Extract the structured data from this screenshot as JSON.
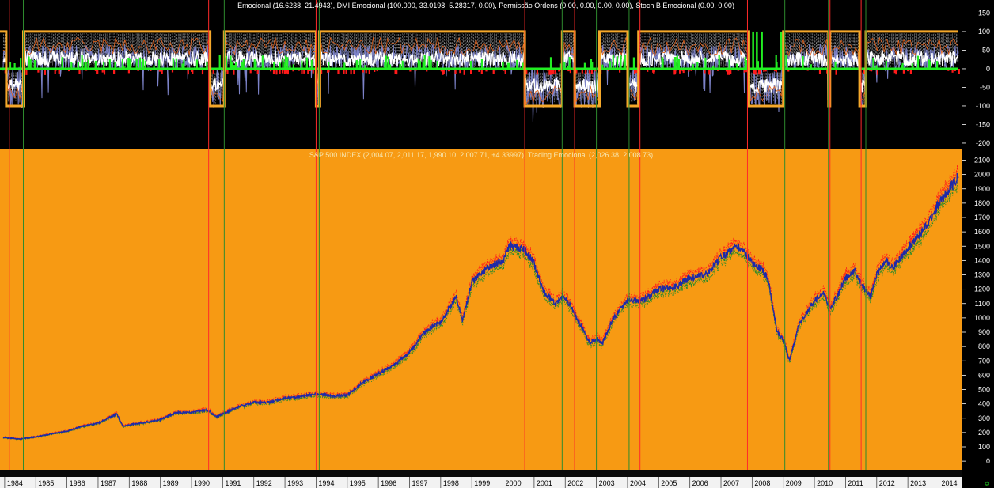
{
  "colors": {
    "osc_bg": "#000000",
    "price_bg": "#F79A13",
    "scale_bg": "#000000",
    "osc_white": "#FFFFFF",
    "osc_blue": "#7C82C8",
    "osc_green": "#22EE22",
    "osc_red": "#FF1A1A",
    "osc_orange_line": "#E0601A",
    "permission_box": "#F5A82A",
    "price_blue": "#1E2AA8",
    "price_red": "#FF1A1A",
    "price_green": "#1F8A2A",
    "vline_red": "#FF2A2A",
    "vline_green": "#2E8B2E",
    "scrollbar": "#000000"
  },
  "oscillator_panel": {
    "legend_text": "Emocional (16.6238, 21.4943), DMI Emocional (100.000, 33.0198, 5.28317, 0.00), Permissão Ordens (0.00, 0.00, 0.00, 0.00), Stoch B Emocional (0.00, 0.00)"
  },
  "price_panel": {
    "legend_text": "S&P 500 INDEX (2,004.07, 2,011.17, 1,990.10, 2,007.71, +4.33997), Trading Emocional (2,026.38, 2,008.73)"
  },
  "chart_data": [
    {
      "type": "line",
      "panel": "oscillator",
      "ylim": [
        -215,
        185
      ],
      "yticks": [
        150,
        100,
        50,
        0,
        -50,
        -100,
        -150,
        -200
      ],
      "ytick_labels": [
        "150",
        "100",
        "50",
        "0",
        "-50",
        "-100",
        "-150",
        "-200"
      ],
      "series": [
        {
          "name": "Permissão Ordens",
          "color": "#F5A82A",
          "segments": [
            {
              "from": 1983.85,
              "to": 1984.05,
              "level": 100
            },
            {
              "from": 1984.05,
              "to": 1984.6,
              "level": -100
            },
            {
              "from": 1984.6,
              "to": 1990.6,
              "level": 100
            },
            {
              "from": 1990.6,
              "to": 1991.05,
              "level": -100
            },
            {
              "from": 1991.05,
              "to": 1994.0,
              "level": 100
            },
            {
              "from": 1994.0,
              "to": 1994.1,
              "level": -100
            },
            {
              "from": 1994.1,
              "to": 2000.7,
              "level": 100
            },
            {
              "from": 2000.7,
              "to": 2001.9,
              "level": -100
            },
            {
              "from": 2001.9,
              "to": 2002.3,
              "level": 100
            },
            {
              "from": 2002.3,
              "to": 2003.1,
              "level": -100
            },
            {
              "from": 2003.1,
              "to": 2004.0,
              "level": 100
            },
            {
              "from": 2004.0,
              "to": 2004.35,
              "level": -100
            },
            {
              "from": 2004.35,
              "to": 2007.9,
              "level": 100
            },
            {
              "from": 2007.9,
              "to": 2009.0,
              "level": -100
            },
            {
              "from": 2009.0,
              "to": 2010.45,
              "level": 100
            },
            {
              "from": 2010.45,
              "to": 2010.5,
              "level": -100
            },
            {
              "from": 2010.5,
              "to": 2011.45,
              "level": 100
            },
            {
              "from": 2011.45,
              "to": 2011.65,
              "level": -100
            },
            {
              "from": 2011.65,
              "to": 2014.6,
              "level": 100
            }
          ]
        },
        {
          "name": "Emocional",
          "color": "#FFFFFF"
        },
        {
          "name": "Stoch B Emocional",
          "color": "#7C82C8"
        },
        {
          "name": "DMI Emocional",
          "color": "#22EE22"
        }
      ]
    },
    {
      "type": "line",
      "panel": "price",
      "title": "S&P 500 INDEX",
      "ylim": [
        -60,
        2180
      ],
      "yticks": [
        2100,
        2000,
        1900,
        1800,
        1700,
        1600,
        1500,
        1400,
        1300,
        1200,
        1100,
        1000,
        900,
        800,
        700,
        600,
        500,
        400,
        300,
        200,
        100,
        0
      ],
      "ytick_labels": [
        "2100",
        "2000",
        "1900",
        "1800",
        "1700",
        "1600",
        "1500",
        "1400",
        "1300",
        "1200",
        "1100",
        "1000",
        "900",
        "800",
        "700",
        "600",
        "500",
        "400",
        "300",
        "200",
        "100",
        "0"
      ],
      "xlim": [
        1983.85,
        2014.75
      ],
      "xticks": [
        1984,
        1985,
        1986,
        1987,
        1988,
        1989,
        1990,
        1991,
        1992,
        1993,
        1994,
        1995,
        1996,
        1997,
        1998,
        1999,
        2000,
        2001,
        2002,
        2003,
        2004,
        2005,
        2006,
        2007,
        2008,
        2009,
        2010,
        2011,
        2012,
        2013,
        2014
      ],
      "xtick_labels": [
        "1984",
        "1985",
        "1986",
        "1987",
        "1988",
        "1989",
        "1990",
        "1991",
        "1992",
        "1993",
        "1994",
        "1995",
        "1996",
        "1997",
        "1998",
        "1999",
        "2000",
        "2001",
        "2002",
        "2003",
        "2004",
        "2005",
        "2006",
        "2007",
        "2008",
        "2009",
        "2010",
        "2011",
        "2012",
        "2013",
        "2014"
      ],
      "series": [
        {
          "name": "S&P 500 INDEX",
          "color": "#1E2AA8",
          "x": [
            1984.0,
            1984.5,
            1985.0,
            1985.5,
            1986.0,
            1986.5,
            1987.0,
            1987.6,
            1987.8,
            1988.0,
            1988.5,
            1989.0,
            1989.5,
            1990.0,
            1990.5,
            1990.8,
            1991.0,
            1991.5,
            1992.0,
            1992.5,
            1993.0,
            1993.5,
            1994.0,
            1994.5,
            1995.0,
            1995.5,
            1996.0,
            1996.5,
            1997.0,
            1997.5,
            1997.8,
            1998.0,
            1998.5,
            1998.7,
            1999.0,
            1999.5,
            2000.0,
            2000.2,
            2000.7,
            2001.0,
            2001.3,
            2001.7,
            2001.9,
            2002.0,
            2002.5,
            2002.8,
            2003.0,
            2003.2,
            2003.5,
            2004.0,
            2004.5,
            2005.0,
            2005.5,
            2006.0,
            2006.5,
            2007.0,
            2007.5,
            2007.8,
            2008.0,
            2008.3,
            2008.5,
            2008.8,
            2009.0,
            2009.2,
            2009.5,
            2010.0,
            2010.3,
            2010.5,
            2010.8,
            2011.0,
            2011.3,
            2011.6,
            2011.8,
            2012.0,
            2012.3,
            2012.5,
            2013.0,
            2013.5,
            2014.0,
            2014.5,
            2014.65
          ],
          "values": [
            165,
            155,
            170,
            190,
            210,
            245,
            265,
            330,
            240,
            255,
            270,
            290,
            340,
            340,
            360,
            310,
            330,
            380,
            410,
            410,
            440,
            450,
            470,
            455,
            460,
            550,
            610,
            670,
            760,
            900,
            950,
            970,
            1150,
            980,
            1250,
            1350,
            1400,
            1500,
            1480,
            1380,
            1180,
            1100,
            1150,
            1150,
            950,
            820,
            860,
            820,
            980,
            1130,
            1120,
            1200,
            1210,
            1280,
            1300,
            1420,
            1500,
            1450,
            1380,
            1340,
            1280,
            900,
            850,
            700,
            950,
            1120,
            1180,
            1060,
            1180,
            1280,
            1330,
            1200,
            1150,
            1300,
            1400,
            1350,
            1480,
            1610,
            1800,
            1950,
            2008
          ]
        }
      ],
      "vertical_lines": {
        "red": [
          1984.15,
          1990.55,
          1994.0,
          2000.7,
          2002.3,
          2004.4,
          2007.85,
          2010.5,
          2011.5
        ],
        "green": [
          1984.6,
          1991.05,
          1994.1,
          2001.9,
          2003.0,
          2004.05,
          2009.05,
          2010.45,
          2011.65
        ]
      }
    }
  ]
}
